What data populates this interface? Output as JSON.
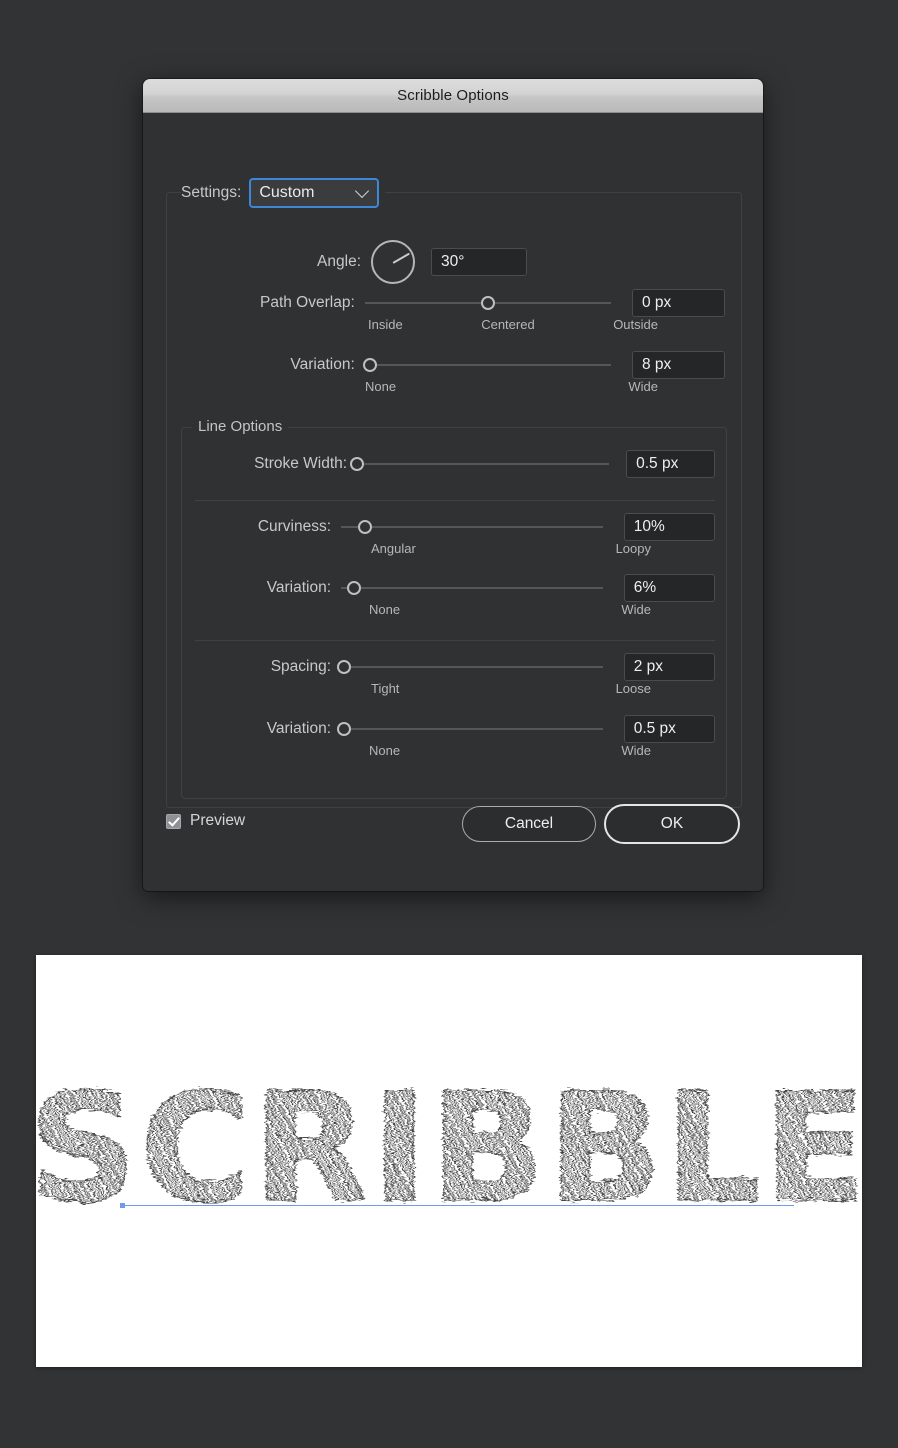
{
  "window": {
    "title": "Scribble Options"
  },
  "settings": {
    "label": "Settings:",
    "value": "Custom",
    "chevron_icon": "chevron-down-icon"
  },
  "angle": {
    "label": "Angle:",
    "value": "30°",
    "degrees": 30,
    "dial_icon": "angle-dial-icon"
  },
  "path_overlap": {
    "label": "Path Overlap:",
    "value": "0 px",
    "handle_percent": 50,
    "ticks": [
      "Inside",
      "Centered",
      "Outside"
    ]
  },
  "path_overlap_variation": {
    "label": "Variation:",
    "value": "8 px",
    "handle_percent": 2,
    "ticks": [
      "None",
      "Wide"
    ]
  },
  "line_options": {
    "title": "Line Options",
    "stroke_width": {
      "label": "Stroke Width:",
      "value": "0.5 px",
      "handle_percent": 0,
      "ticks": []
    },
    "curviness": {
      "label": "Curviness:",
      "value": "10%",
      "handle_percent": 9,
      "ticks": [
        "Angular",
        "Loopy"
      ]
    },
    "curviness_variation": {
      "label": "Variation:",
      "value": "6%",
      "handle_percent": 5,
      "ticks": [
        "None",
        "Wide"
      ]
    },
    "spacing": {
      "label": "Spacing:",
      "value": "2 px",
      "handle_percent": 1,
      "ticks": [
        "Tight",
        "Loose"
      ]
    },
    "spacing_variation": {
      "label": "Variation:",
      "value": "0.5 px",
      "handle_percent": 1,
      "ticks": [
        "None",
        "Wide"
      ]
    }
  },
  "footer": {
    "preview_label": "Preview",
    "preview_checked": true,
    "cancel_label": "Cancel",
    "ok_label": "OK"
  },
  "canvas": {
    "artwork_text": "SCRIBBLE",
    "baseline_color": "#6f9bea",
    "background": "#ffffff"
  },
  "colors": {
    "accent_blue": "#3d86d8",
    "dialog_bg": "#2f3133",
    "page_bg": "#313335",
    "field_bg": "#242628",
    "text": "#c8c8c8"
  }
}
